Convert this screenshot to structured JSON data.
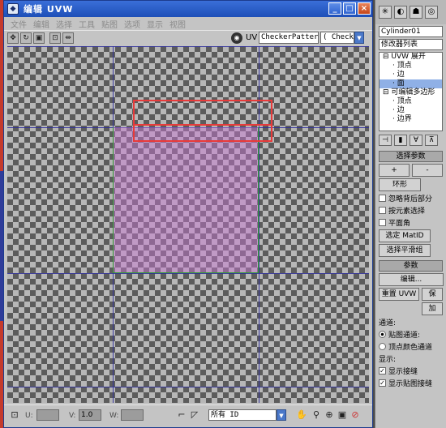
{
  "window": {
    "title": "编辑 UVW",
    "buttons": {
      "minimize": "_",
      "maximize": "□",
      "close": "×"
    }
  },
  "menu": {
    "items": [
      "文件",
      "编辑",
      "选择",
      "工具",
      "贴图",
      "选项",
      "显示",
      "视图"
    ]
  },
  "toolbar": {
    "uv_label": "UV",
    "texture_select": "CheckerPattern",
    "map_select": "( Checke"
  },
  "status": {
    "u_label": "U:",
    "v_label": "V:",
    "v_value": "1.0",
    "w_label": "W:",
    "id_filter": "所有 ID"
  },
  "command_panel": {
    "object_name": "Cylinder01",
    "modifier_list": "修改器列表",
    "stack": [
      {
        "label": "UVW 展开",
        "level": 0
      },
      {
        "label": "顶点",
        "level": 1
      },
      {
        "label": "边",
        "level": 1
      },
      {
        "label": "面",
        "level": 1,
        "selected": true
      },
      {
        "label": "可编辑多边形",
        "level": 0
      },
      {
        "label": "顶点",
        "level": 1
      },
      {
        "label": "边",
        "level": 1
      },
      {
        "label": "边界",
        "level": 1
      }
    ],
    "select_rollout": {
      "title": "选择参数",
      "plus_label": "+",
      "minus_label": "-",
      "ring_label": "环形",
      "ignore_backfacing": "忽略背后部分",
      "select_by_element": "按元素选择",
      "planar_angle": "平面角",
      "select_matid": "选定 MatID",
      "select_smoothing": "选择平滑组"
    },
    "params_rollout": {
      "title": "参数",
      "edit_button": "编辑...",
      "reset_uvw": "重置 UVW",
      "save_label": "保",
      "load_label": "加",
      "channel_label": "通道:",
      "map_channel": "贴图通道:",
      "vertex_color_channel": "顶点颜色通道",
      "display_label": "显示:",
      "show_seams": "显示接缝",
      "show_map_seams": "显示贴图接缝"
    }
  }
}
